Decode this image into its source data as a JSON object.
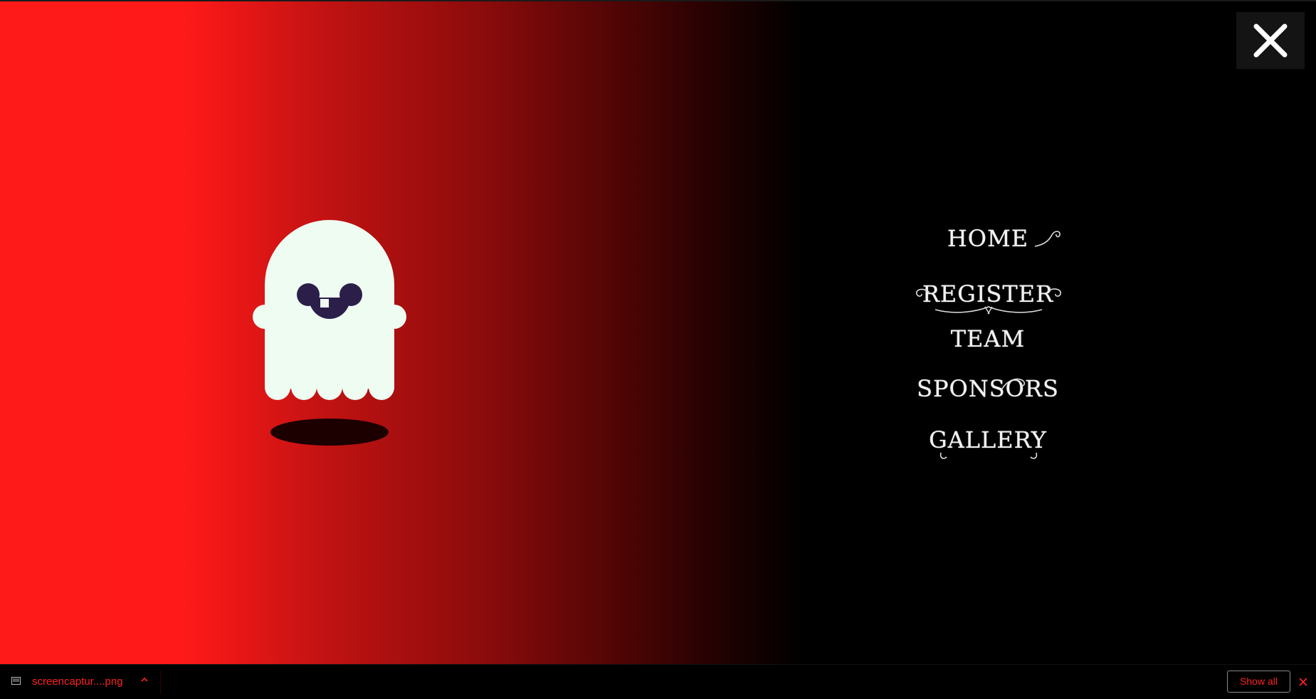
{
  "nav": {
    "close_icon": "close-icon",
    "items": [
      {
        "label": "HOME"
      },
      {
        "label": "REGISTER"
      },
      {
        "label": "TEAM"
      },
      {
        "label": "SPONSORS"
      },
      {
        "label": "GALLERY"
      }
    ]
  },
  "hero": {
    "illustration": "ghost-icon"
  },
  "download_bar": {
    "file_name": "screencaptur....png",
    "show_all_label": "Show all",
    "close_icon": "close-icon"
  },
  "colors": {
    "accent_red": "#ff1a1a",
    "background": "#000000",
    "ghost_body": "#eefcf2",
    "ghost_face": "#2b1f4a",
    "menu_text": "#f2f2f2"
  }
}
